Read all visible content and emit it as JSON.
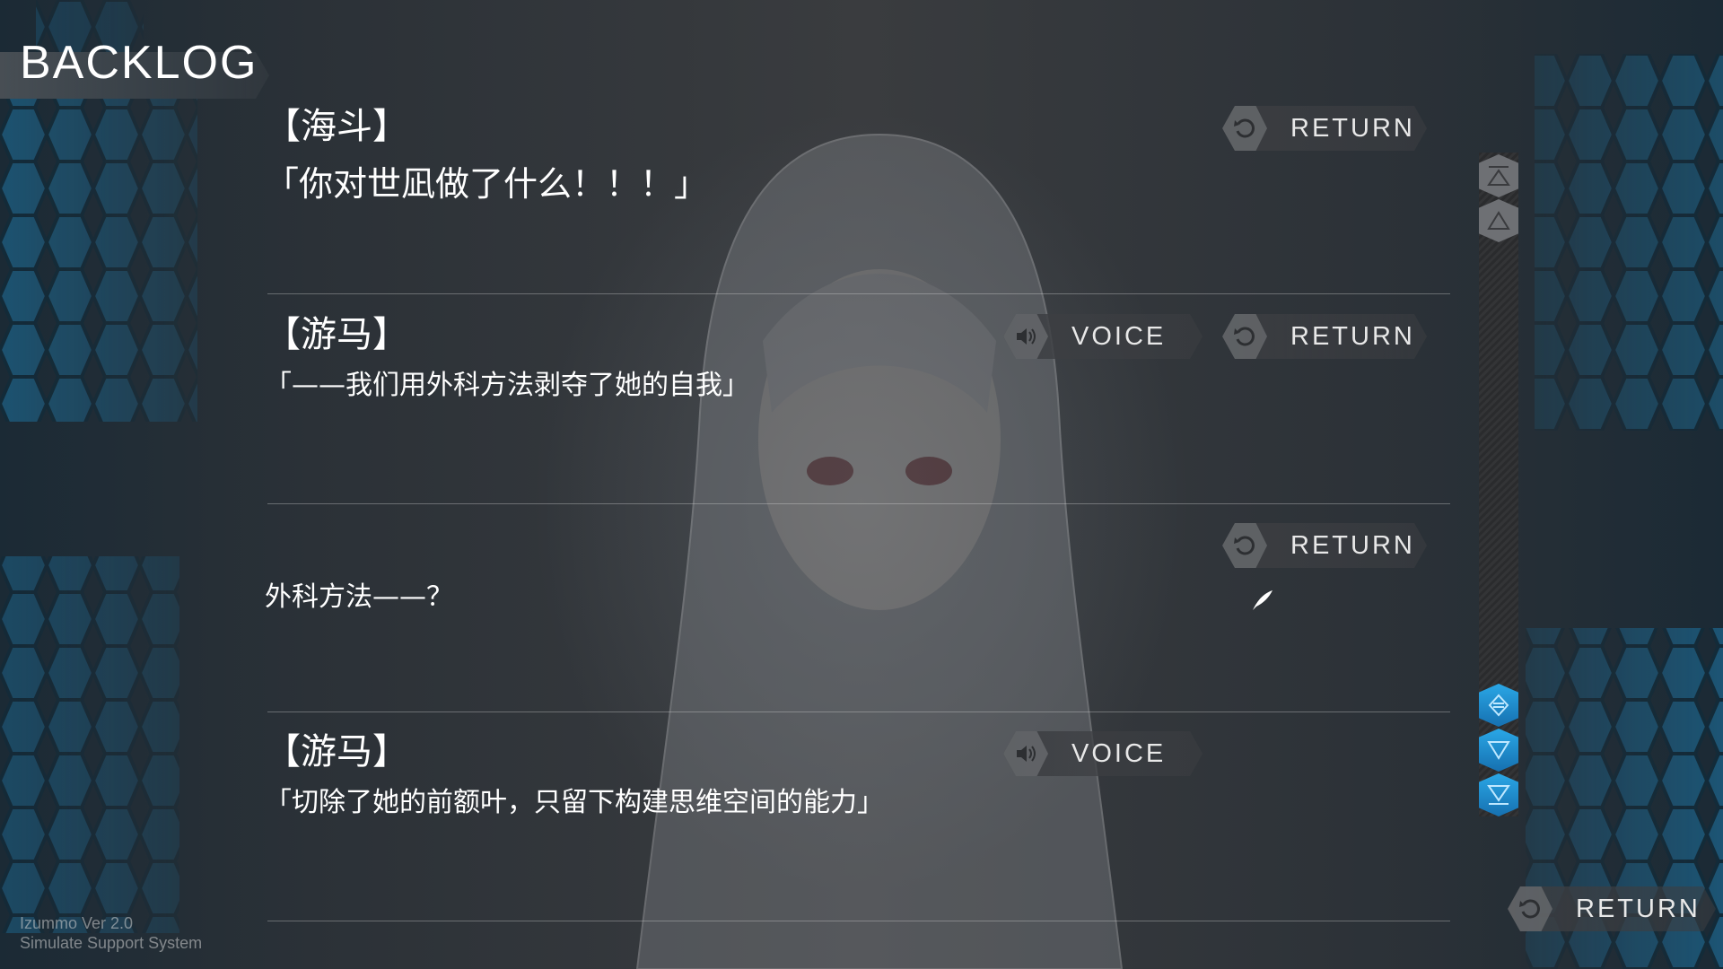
{
  "screen": {
    "title": "BACKLOG",
    "version_line1": "Izummo Ver 2.0",
    "version_line2": "Simulate Support System"
  },
  "buttons": {
    "return_label": "RETURN",
    "voice_label": "VOICE"
  },
  "entries": [
    {
      "speaker": "【海斗】",
      "text": "「你对世凪做了什么！！！」",
      "has_voice": false,
      "has_return": true
    },
    {
      "speaker": "【游马】",
      "text": "「——我们用外科方法剥夺了她的自我」",
      "has_voice": true,
      "has_return": true
    },
    {
      "speaker": "",
      "text": "外科方法——？",
      "has_voice": false,
      "has_return": true
    },
    {
      "speaker": "【游马】",
      "text": "「切除了她的前额叶，只留下构建思维空间的能力」",
      "has_voice": true,
      "has_return": false
    }
  ],
  "colors": {
    "accent_blue": "#2aa7e6",
    "button_gray": "#3c3e42",
    "text_white": "#ffffff"
  },
  "icons": {
    "return": "return-arrow-icon",
    "voice": "speaker-icon",
    "scroll_top": "scroll-top-icon",
    "scroll_up": "scroll-up-icon",
    "scroll_current": "scroll-current-icon",
    "scroll_down": "scroll-down-icon",
    "scroll_bottom": "scroll-bottom-icon",
    "cursor": "feather-cursor-icon"
  }
}
